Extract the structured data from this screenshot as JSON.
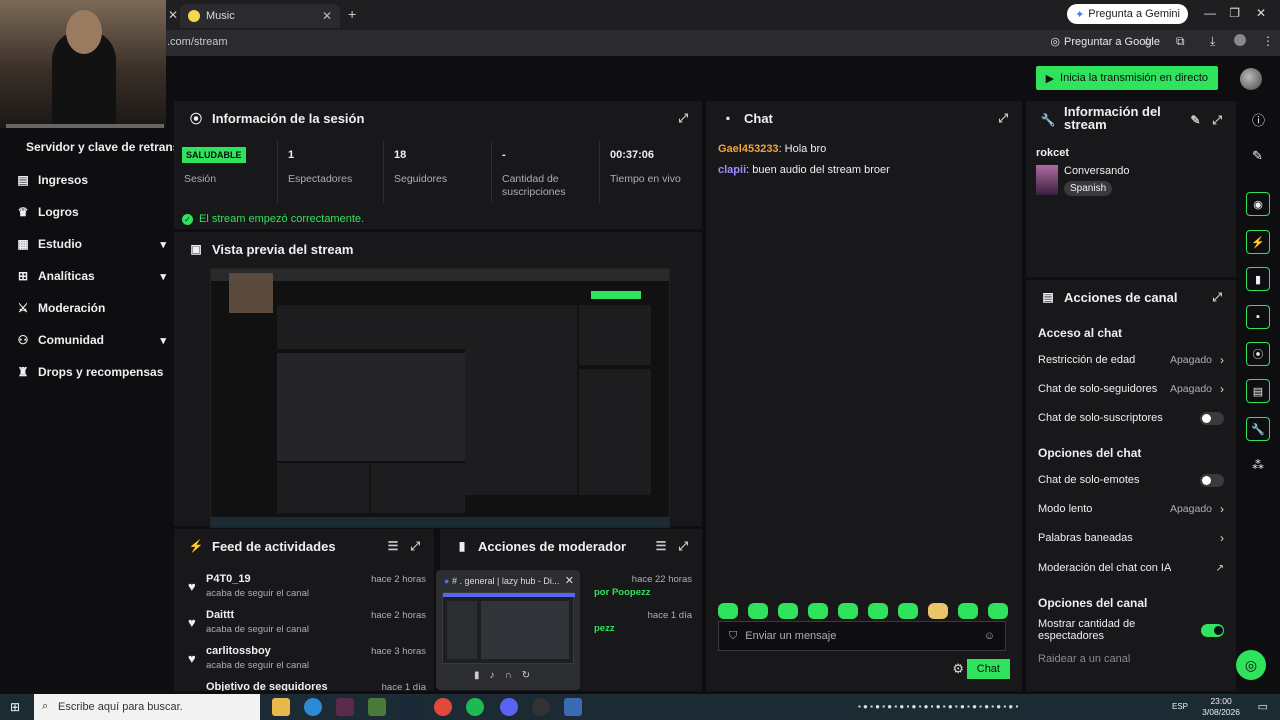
{
  "browser": {
    "tab_title": "Music",
    "url": ".com/stream",
    "gemini_label": "Pregunta a Gemini",
    "ask_google_label": "Preguntar a Google"
  },
  "topbar": {
    "live_button_label": "Inicia la transmisión en directo"
  },
  "sidebar": {
    "title": "Servidor y clave de retransn",
    "items": [
      {
        "label": "Ingresos",
        "icon": "dollar-icon"
      },
      {
        "label": "Logros",
        "icon": "trophy-icon"
      },
      {
        "label": "Estudio",
        "icon": "studio-icon"
      },
      {
        "label": "Analíticas",
        "icon": "chart-icon"
      },
      {
        "label": "Moderación",
        "icon": "sword-icon"
      },
      {
        "label": "Comunidad",
        "icon": "people-icon"
      },
      {
        "label": "Drops y recompensas",
        "icon": "gift-icon"
      }
    ]
  },
  "session": {
    "title": "Información de la sesión",
    "status_badge": "SALUDABLE",
    "status_label": "Sesión",
    "viewers_value": "1",
    "viewers_label": "Espectadores",
    "followers_value": "18",
    "followers_label": "Seguidores",
    "subs_value": "-",
    "subs_label": "Cantidad de suscripciones",
    "live_time_value": "00:37:06",
    "live_time_label": "Tiempo en vivo",
    "ok_message": "El stream empezó correctamente."
  },
  "preview": {
    "title": "Vista previa del stream"
  },
  "activity_feed": {
    "title": "Feed de actividades",
    "items": [
      {
        "name": "P4T0_19",
        "desc": "acaba de seguir el canal",
        "time": "hace 2 horas"
      },
      {
        "name": "Daittt",
        "desc": "acaba de seguir el canal",
        "time": "hace 2 horas"
      },
      {
        "name": "carlitossboy",
        "desc": "acaba de seguir el canal",
        "time": "hace 3 horas"
      },
      {
        "name": "Objetivo de seguidores",
        "desc": "",
        "time": "hace 1 día"
      }
    ]
  },
  "mod_actions": {
    "title": "Acciones de moderador",
    "items": [
      {
        "text": "por Poopezz",
        "time": "hace 22 horas"
      },
      {
        "text": "pezz",
        "time": "hace 1 día"
      }
    ]
  },
  "chat": {
    "title": "Chat",
    "messages": [
      {
        "user": "Gael453233",
        "text": ": Hola bro",
        "color": "#f0a33c"
      },
      {
        "user": "clapii",
        "text": ": buen audio del stream broer",
        "color": "#9d8cff"
      }
    ],
    "input_placeholder": "Enviar un mensaje",
    "send_label": "Chat"
  },
  "stream_info": {
    "title": "Información del stream",
    "username": "rokcet",
    "category": "Conversando",
    "tag": "Spanish"
  },
  "channel_actions": {
    "title": "Acciones de canal",
    "chat_access_title": "Acceso al chat",
    "age_restriction": {
      "label": "Restricción de edad",
      "value": "Apagado"
    },
    "followers_only": {
      "label": "Chat de solo-seguidores",
      "value": "Apagado"
    },
    "subs_only": {
      "label": "Chat de solo-suscriptores"
    },
    "chat_options_title": "Opciones del chat",
    "emotes_only": {
      "label": "Chat de solo-emotes"
    },
    "slow_mode": {
      "label": "Modo lento",
      "value": "Apagado"
    },
    "banned_words": {
      "label": "Palabras baneadas"
    },
    "ai_mod": {
      "label": "Moderación del chat con IA"
    },
    "channel_options_title": "Opciones del canal",
    "show_viewers": {
      "label": "Mostrar cantidad de espectadores"
    },
    "raid": {
      "label": "Raidear a un canal"
    }
  },
  "discord_popup": {
    "title": "# . general | lazy hub - Di..."
  },
  "taskbar": {
    "search_placeholder": "Escribe aquí para buscar.",
    "lang": "ESP",
    "time": "23:00",
    "date": "3/08/2026"
  },
  "colors": {
    "accent": "#2fe35c",
    "bg": "#0e0e10",
    "panel": "#18181b"
  }
}
